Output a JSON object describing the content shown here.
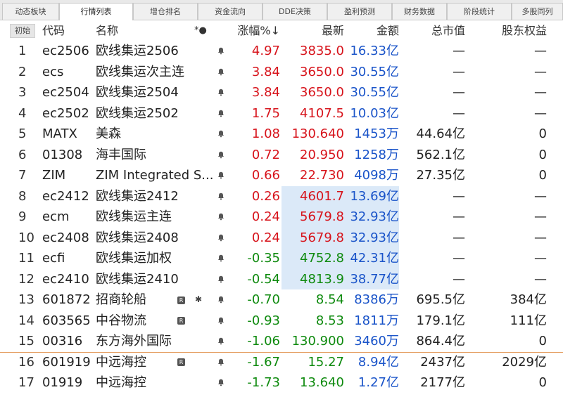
{
  "tabs": [
    "动态板块",
    "行情列表",
    "增仓排名",
    "资金流向",
    "DDE决策",
    "盈利预测",
    "财务数据",
    "阶段统计",
    "多股同列"
  ],
  "active_tab": 1,
  "header": {
    "init_button": "初始",
    "code": "代码",
    "name": "名称",
    "flags": "*●",
    "change": "涨幅%↓",
    "last": "最新",
    "amount": "金额",
    "market_cap": "总市值",
    "equity": "股东权益"
  },
  "rows": [
    {
      "idx": "1",
      "code": "ec2506",
      "name": "欧线集运2506",
      "r": false,
      "star": false,
      "change": "4.97",
      "dir": "up",
      "last": "3835.0",
      "amount": "16.33亿",
      "mcap": "—",
      "equity": "—"
    },
    {
      "idx": "2",
      "code": "ecs",
      "name": "欧线集运次主连",
      "r": false,
      "star": false,
      "change": "3.84",
      "dir": "up",
      "last": "3650.0",
      "amount": "30.55亿",
      "mcap": "—",
      "equity": "—"
    },
    {
      "idx": "3",
      "code": "ec2504",
      "name": "欧线集运2504",
      "r": false,
      "star": false,
      "change": "3.84",
      "dir": "up",
      "last": "3650.0",
      "amount": "30.55亿",
      "mcap": "—",
      "equity": "—"
    },
    {
      "idx": "4",
      "code": "ec2502",
      "name": "欧线集运2502",
      "r": false,
      "star": false,
      "change": "1.75",
      "dir": "up",
      "last": "4107.5",
      "amount": "10.03亿",
      "mcap": "—",
      "equity": "—"
    },
    {
      "idx": "5",
      "code": "MATX",
      "name": "美森",
      "r": false,
      "star": false,
      "change": "1.08",
      "dir": "up",
      "last": "130.640",
      "amount": "1453万",
      "mcap": "44.64亿",
      "equity": "0"
    },
    {
      "idx": "6",
      "code": "01308",
      "name": "海丰国际",
      "r": false,
      "star": false,
      "change": "0.72",
      "dir": "up",
      "last": "20.950",
      "amount": "1258万",
      "mcap": "562.1亿",
      "equity": "0"
    },
    {
      "idx": "7",
      "code": "ZIM",
      "name": "ZIM Integrated S...",
      "r": false,
      "star": false,
      "change": "0.66",
      "dir": "up",
      "last": "22.730",
      "amount": "4098万",
      "mcap": "27.35亿",
      "equity": "0"
    },
    {
      "idx": "8",
      "code": "ec2412",
      "name": "欧线集运2412",
      "r": false,
      "star": false,
      "change": "0.26",
      "dir": "up",
      "last": "4601.7",
      "amount": "13.69亿",
      "mcap": "—",
      "equity": "—",
      "hl": true
    },
    {
      "idx": "9",
      "code": "ecm",
      "name": "欧线集运主连",
      "r": false,
      "star": false,
      "change": "0.24",
      "dir": "up",
      "last": "5679.8",
      "amount": "32.93亿",
      "mcap": "—",
      "equity": "—",
      "hl": true
    },
    {
      "idx": "10",
      "code": "ec2408",
      "name": "欧线集运2408",
      "r": false,
      "star": false,
      "change": "0.24",
      "dir": "up",
      "last": "5679.8",
      "amount": "32.93亿",
      "mcap": "—",
      "equity": "—",
      "hl": true
    },
    {
      "idx": "11",
      "code": "ecfi",
      "name": "欧线集运加权",
      "r": false,
      "star": false,
      "change": "-0.35",
      "dir": "down",
      "last": "4752.8",
      "amount": "42.31亿",
      "mcap": "—",
      "equity": "—",
      "hl": true
    },
    {
      "idx": "12",
      "code": "ec2410",
      "name": "欧线集运2410",
      "r": false,
      "star": false,
      "change": "-0.54",
      "dir": "down",
      "last": "4813.9",
      "amount": "38.77亿",
      "mcap": "—",
      "equity": "—",
      "hl": true
    },
    {
      "idx": "13",
      "code": "601872",
      "name": "招商轮船",
      "r": true,
      "star": true,
      "change": "-0.70",
      "dir": "down",
      "last": "8.54",
      "amount": "8386万",
      "mcap": "695.5亿",
      "equity": "384亿"
    },
    {
      "idx": "14",
      "code": "603565",
      "name": "中谷物流",
      "r": true,
      "star": false,
      "change": "-0.93",
      "dir": "down",
      "last": "8.53",
      "amount": "1811万",
      "mcap": "179.1亿",
      "equity": "111亿"
    },
    {
      "idx": "15",
      "code": "00316",
      "name": "东方海外国际",
      "r": false,
      "star": false,
      "change": "-1.06",
      "dir": "down",
      "last": "130.900",
      "amount": "3460万",
      "mcap": "864.4亿",
      "equity": "0"
    },
    {
      "idx": "16",
      "code": "601919",
      "name": "中远海控",
      "r": true,
      "star": false,
      "change": "-1.67",
      "dir": "down",
      "last": "15.27",
      "amount": "8.94亿",
      "mcap": "2437亿",
      "equity": "2029亿"
    },
    {
      "idx": "17",
      "code": "01919",
      "name": "中远海控",
      "r": false,
      "star": false,
      "change": "-1.73",
      "dir": "down",
      "last": "13.640",
      "amount": "1.27亿",
      "mcap": "2177亿",
      "equity": "0"
    }
  ],
  "icons": {
    "r_badge": "R",
    "star": "✱",
    "bell": "bell-icon"
  },
  "colors": {
    "up": "#d7131b",
    "down": "#0e8a0e",
    "amount": "#1a54c9",
    "highlight": "#dbe9f8",
    "separator": "#e39a5a"
  }
}
